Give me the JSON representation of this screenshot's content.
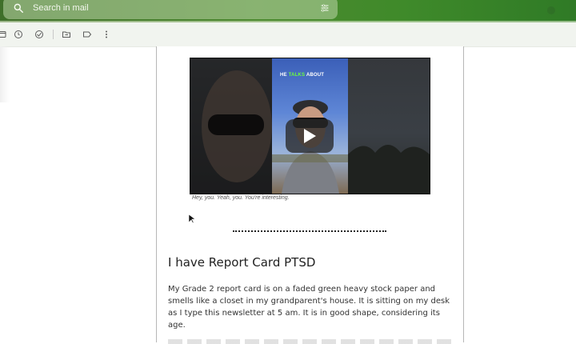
{
  "search": {
    "placeholder": "Search in mail",
    "search_icon": "search-icon",
    "options_icon": "tune-icon"
  },
  "toolbar": {
    "icons": [
      "archive-icon",
      "snooze-icon",
      "add-task-icon",
      "move-to-icon",
      "label-icon",
      "more-vert-icon"
    ]
  },
  "email": {
    "video": {
      "overlay_text_parts": [
        "HE ",
        "TALKS",
        " ABOUT"
      ],
      "caption": "Hey, you. Yeah, you. You're interesting.",
      "play_icon": "play-icon"
    },
    "section_heading": "I have Report Card PTSD",
    "paragraph": "My Grade 2 report card is on a faded green heavy stock paper and smells like a closet in my grandparent's house. It is sitting on my desk as I type this newsletter at 5 am. It is in good shape, considering its age."
  },
  "colors": {
    "topbar": "#4c8a2f",
    "toolbar": "#f1f4ef",
    "text": "#333333",
    "accent_green_text": "#6cff3a"
  }
}
